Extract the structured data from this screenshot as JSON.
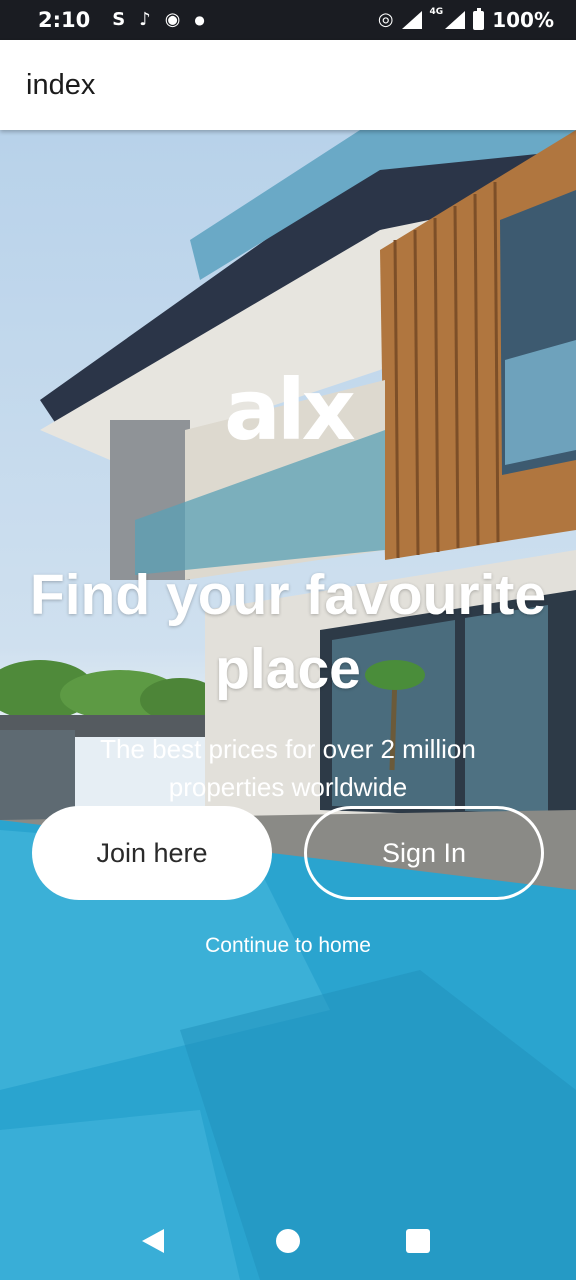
{
  "status_bar": {
    "time": "2:10",
    "left_icons": [
      "sim-s-icon",
      "tiktok-icon",
      "chrome-icon",
      "dot-icon"
    ],
    "signal_label": "4G",
    "battery_text": "100%"
  },
  "app_bar": {
    "title": "index"
  },
  "hero": {
    "logo": "alx",
    "headline": "Find your favourite place",
    "subtitle": "The best prices for over 2 million properties worldwide",
    "join_label": "Join here",
    "signin_label": "Sign In",
    "continue_label": "Continue to home"
  },
  "nav_bar": {
    "icons": [
      "back-icon",
      "home-icon",
      "recents-icon"
    ]
  }
}
